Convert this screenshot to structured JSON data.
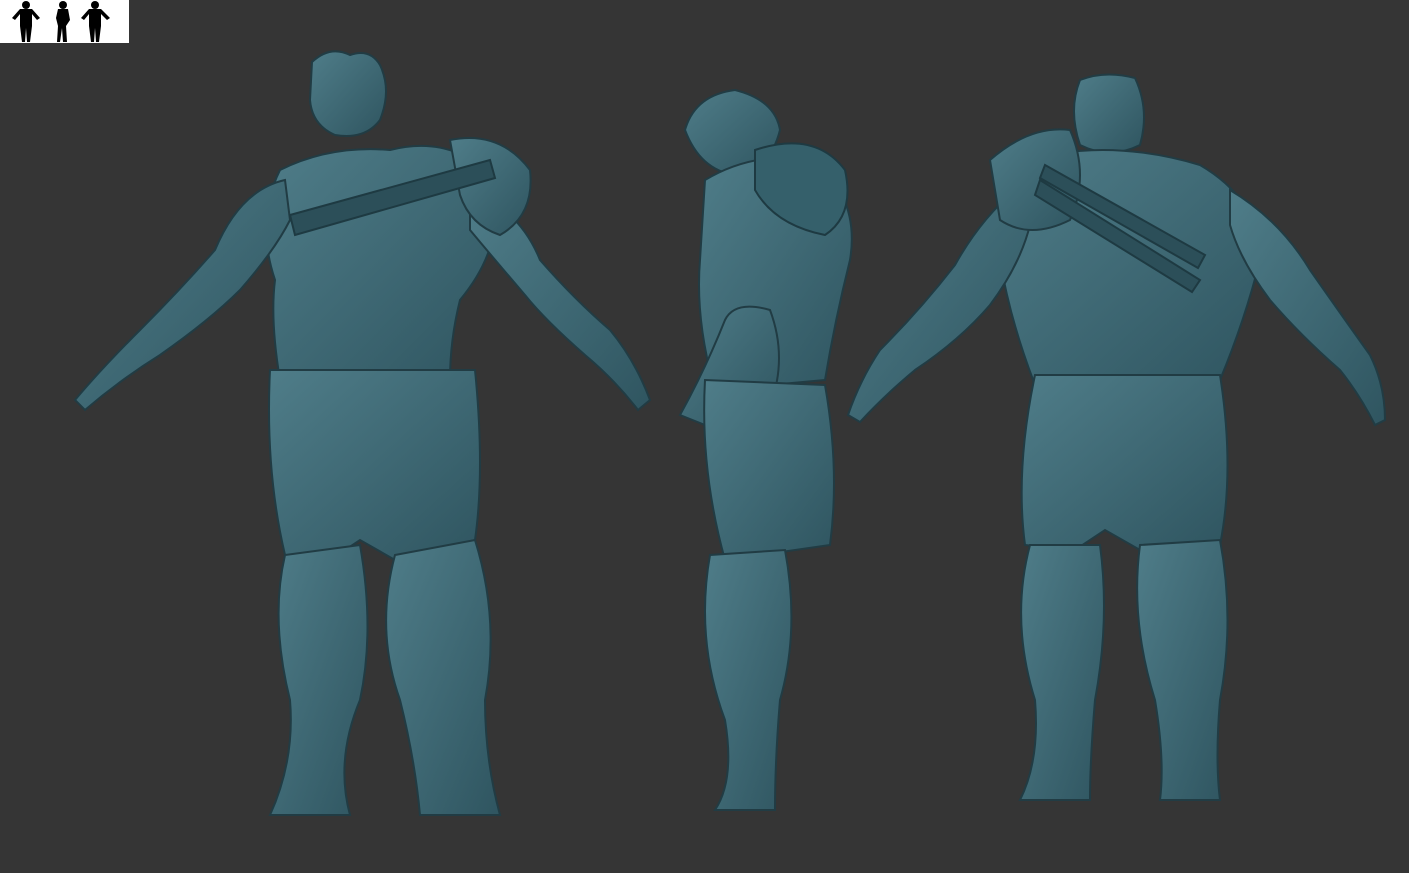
{
  "scene": {
    "background_color": "#353535",
    "model_color": "#3f6a76",
    "model_shadow": "#24434c",
    "model_highlight": "#6d9aa6",
    "views": [
      {
        "id": "front",
        "label": ""
      },
      {
        "id": "side",
        "label": ""
      },
      {
        "id": "back",
        "label": ""
      }
    ]
  },
  "thumbnail": {
    "background_color": "#ffffff",
    "silhouette_color": "#000000",
    "figures": 3
  }
}
